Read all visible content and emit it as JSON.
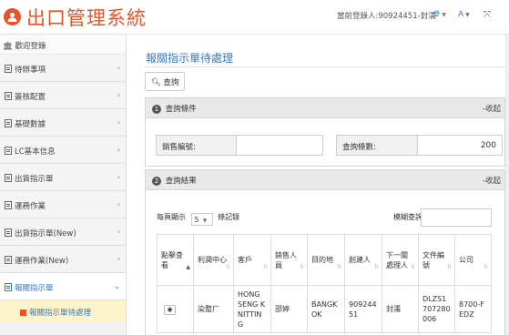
{
  "header": {
    "app_title": "出口管理系統",
    "user_info": "當前登錄人:90924451-封濡",
    "font_label": "A"
  },
  "sidebar": {
    "home_label": "歡迎登錄",
    "items": [
      {
        "label": "待辦事項"
      },
      {
        "label": "簽核配置"
      },
      {
        "label": "基礎數據"
      },
      {
        "label": "LC基本信息"
      },
      {
        "label": "出貨指示單"
      },
      {
        "label": "運務作業"
      },
      {
        "label": "出貨指示單(New)"
      },
      {
        "label": "運務作業(New)"
      },
      {
        "label": "報關指示單"
      }
    ],
    "active_sub": "報關指示單待處理"
  },
  "main": {
    "page_title": "報關指示單待處理",
    "query_button": "查詢",
    "condition_panel": {
      "number": "1",
      "title": "查詢條件",
      "collapse": "-收起",
      "sales_no_label": "銷售編號:",
      "sales_no_value": "",
      "query_count_label": "查詢條數:",
      "query_count_value": "200"
    },
    "result_panel": {
      "number": "2",
      "title": "查詢結果",
      "collapse": "-收起",
      "page_size_prefix": "每頁顯示",
      "page_size_value": "5",
      "page_size_suffix": "條記錄",
      "fuzzy_label": "模糊查詢:",
      "columns": [
        "點擊查看",
        "利潤中心",
        "客戶",
        "銷售人員",
        "目的地",
        "創建人",
        "下一關處理人",
        "文件編號",
        "公司"
      ],
      "rows": [
        {
          "view": "",
          "profit_center": "染整厂",
          "customer": "HONG SENG KNITTING",
          "sales": "邵婷",
          "destination": "BANGKOK",
          "creator": "90924451",
          "next_handler": "封濡",
          "doc_no": "DLZS1707280006",
          "company": "8700-FEDZ"
        }
      ]
    }
  }
}
